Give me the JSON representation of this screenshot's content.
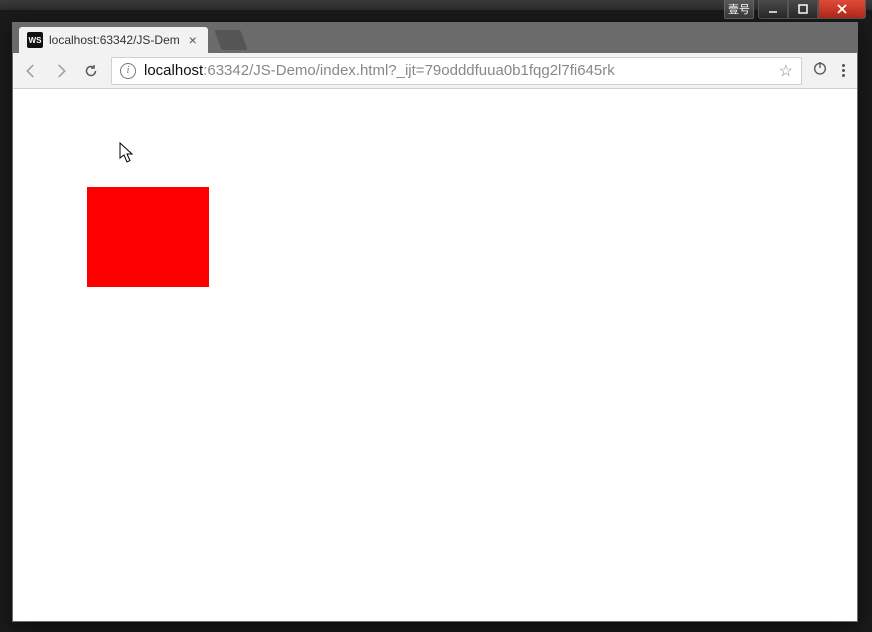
{
  "window": {
    "language_indicator": "壹号"
  },
  "browser": {
    "tab": {
      "favicon_label": "WS",
      "title": "localhost:63342/JS-Dem"
    },
    "url": {
      "host": "localhost",
      "rest": ":63342/JS-Demo/index.html?_ijt=79odddfuua0b1fqg2l7fi645rk"
    }
  },
  "page": {
    "box_color": "#ff0000"
  }
}
